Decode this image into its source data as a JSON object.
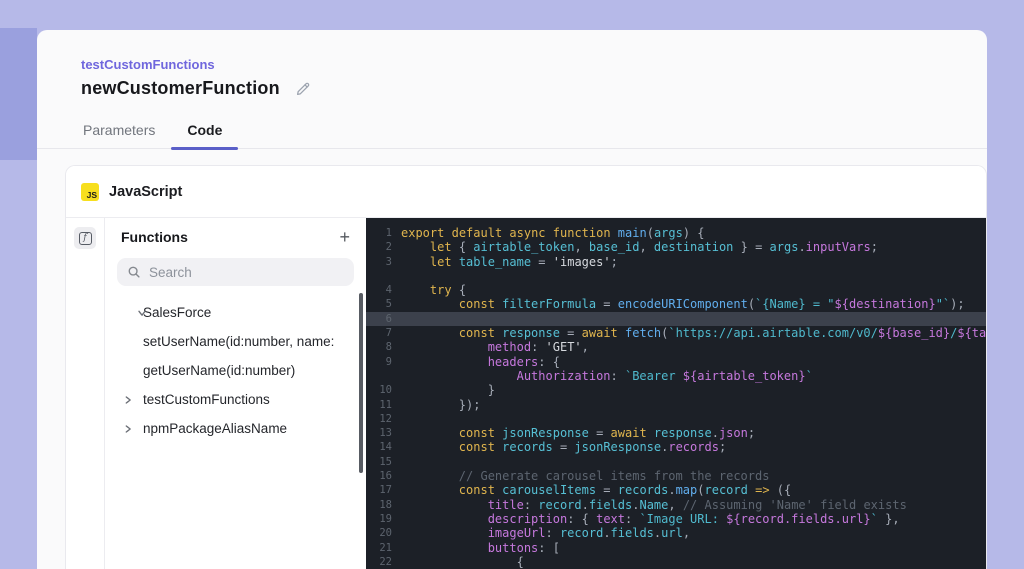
{
  "page": {
    "background_color": "#b6b9e8",
    "accent_color": "#5a5fc8",
    "breadcrumb_color": "#6f66dd"
  },
  "header": {
    "breadcrumb": "testCustomFunctions",
    "title": "newCustomerFunction",
    "tabs": [
      {
        "label": "Parameters",
        "active": false
      },
      {
        "label": "Code",
        "active": true
      }
    ]
  },
  "editor_card": {
    "language_badge": "JS",
    "language_badge_color": "#f7df1e",
    "language_label": "JavaScript"
  },
  "functions_panel": {
    "title": "Functions",
    "add_button": "+",
    "search_placeholder": "Search",
    "tree": [
      {
        "chevron": "down",
        "label": "SalesForce"
      },
      {
        "chevron": "",
        "label": "setUserName(id:number, name:"
      },
      {
        "chevron": "",
        "label": "getUserName(id:number)"
      },
      {
        "chevron": "right",
        "label": "testCustomFunctions"
      },
      {
        "chevron": "right",
        "label": "npmPackageAliasName"
      }
    ]
  },
  "code_editor": {
    "background_color": "#1c2027",
    "active_line_color": "#3c414c",
    "active_line_number": "6",
    "lines": [
      {
        "n": "1",
        "hl": false,
        "toks": [
          [
            "kw",
            "export"
          ],
          [
            "o",
            " "
          ],
          [
            "kw",
            "default"
          ],
          [
            "o",
            " "
          ],
          [
            "kw",
            "async"
          ],
          [
            "o",
            " "
          ],
          [
            "kw",
            "function"
          ],
          [
            "o",
            " "
          ],
          [
            "fn",
            "main"
          ],
          [
            "o",
            "("
          ],
          [
            "v",
            "args"
          ],
          [
            "o",
            ") {"
          ]
        ]
      },
      {
        "n": "2",
        "hl": false,
        "toks": [
          [
            "o",
            "    "
          ],
          [
            "kw",
            "let"
          ],
          [
            "o",
            " { "
          ],
          [
            "v",
            "airtable_token"
          ],
          [
            "o",
            ", "
          ],
          [
            "v",
            "base_id"
          ],
          [
            "o",
            ", "
          ],
          [
            "v",
            "destination"
          ],
          [
            "o",
            " } = "
          ],
          [
            "v",
            "args"
          ],
          [
            "o",
            "."
          ],
          [
            "p",
            "inputVars"
          ],
          [
            "o",
            ";"
          ]
        ]
      },
      {
        "n": "3",
        "hl": false,
        "toks": [
          [
            "o",
            "    "
          ],
          [
            "kw",
            "let"
          ],
          [
            "o",
            " "
          ],
          [
            "v",
            "table_name"
          ],
          [
            "o",
            " = "
          ],
          [
            "s",
            "'images'"
          ],
          [
            "o",
            ";"
          ]
        ]
      },
      {
        "n": "",
        "hl": false,
        "toks": []
      },
      {
        "n": "4",
        "hl": false,
        "toks": [
          [
            "o",
            "    "
          ],
          [
            "kw",
            "try"
          ],
          [
            "o",
            " {"
          ]
        ]
      },
      {
        "n": "5",
        "hl": false,
        "toks": [
          [
            "o",
            "        "
          ],
          [
            "kw",
            "const"
          ],
          [
            "o",
            " "
          ],
          [
            "v",
            "filterFormula"
          ],
          [
            "o",
            " = "
          ],
          [
            "fn",
            "encodeURIComponent"
          ],
          [
            "o",
            "("
          ],
          [
            "t",
            "`{Name} = \""
          ],
          [
            "p",
            "${destination}"
          ],
          [
            "t",
            "\"`"
          ],
          [
            "o",
            ");"
          ]
        ]
      },
      {
        "n": "6",
        "hl": true,
        "toks": []
      },
      {
        "n": "7",
        "hl": false,
        "toks": [
          [
            "o",
            "        "
          ],
          [
            "kw",
            "const"
          ],
          [
            "o",
            " "
          ],
          [
            "v",
            "response"
          ],
          [
            "o",
            " = "
          ],
          [
            "kw",
            "await"
          ],
          [
            "o",
            " "
          ],
          [
            "fn",
            "fetch"
          ],
          [
            "o",
            "("
          ],
          [
            "t",
            "`https://api.airtable.com/v0/"
          ],
          [
            "p",
            "${base_id}"
          ],
          [
            "t",
            "/"
          ],
          [
            "p",
            "${ta"
          ]
        ]
      },
      {
        "n": "8",
        "hl": false,
        "toks": [
          [
            "o",
            "            "
          ],
          [
            "p",
            "method"
          ],
          [
            "o",
            ": "
          ],
          [
            "s",
            "'GET'"
          ],
          [
            "o",
            ","
          ]
        ]
      },
      {
        "n": "9",
        "hl": false,
        "toks": [
          [
            "o",
            "            "
          ],
          [
            "p",
            "headers"
          ],
          [
            "o",
            ": {"
          ]
        ]
      },
      {
        "n": "",
        "hl": false,
        "toks": [
          [
            "o",
            "                "
          ],
          [
            "p",
            "Authorization"
          ],
          [
            "o",
            ": "
          ],
          [
            "t",
            "`Bearer "
          ],
          [
            "p",
            "${airtable_token}"
          ],
          [
            "t",
            "`"
          ]
        ]
      },
      {
        "n": "10",
        "hl": false,
        "toks": [
          [
            "o",
            "            }"
          ]
        ]
      },
      {
        "n": "11",
        "hl": false,
        "toks": [
          [
            "o",
            "        });"
          ]
        ]
      },
      {
        "n": "12",
        "hl": false,
        "toks": []
      },
      {
        "n": "13",
        "hl": false,
        "toks": [
          [
            "o",
            "        "
          ],
          [
            "kw",
            "const"
          ],
          [
            "o",
            " "
          ],
          [
            "v",
            "jsonResponse"
          ],
          [
            "o",
            " = "
          ],
          [
            "kw",
            "await"
          ],
          [
            "o",
            " "
          ],
          [
            "v",
            "response"
          ],
          [
            "o",
            "."
          ],
          [
            "p",
            "json"
          ],
          [
            "o",
            ";"
          ]
        ]
      },
      {
        "n": "14",
        "hl": false,
        "toks": [
          [
            "o",
            "        "
          ],
          [
            "kw",
            "const"
          ],
          [
            "o",
            " "
          ],
          [
            "v",
            "records"
          ],
          [
            "o",
            " = "
          ],
          [
            "v",
            "jsonResponse"
          ],
          [
            "o",
            "."
          ],
          [
            "p",
            "records"
          ],
          [
            "o",
            ";"
          ]
        ]
      },
      {
        "n": "15",
        "hl": false,
        "toks": []
      },
      {
        "n": "16",
        "hl": false,
        "toks": [
          [
            "o",
            "        "
          ],
          [
            "c",
            "// Generate carousel items from the records"
          ]
        ]
      },
      {
        "n": "17",
        "hl": false,
        "toks": [
          [
            "o",
            "        "
          ],
          [
            "kw",
            "const"
          ],
          [
            "o",
            " "
          ],
          [
            "v",
            "carouselItems"
          ],
          [
            "o",
            " = "
          ],
          [
            "v",
            "records"
          ],
          [
            "o",
            "."
          ],
          [
            "fn",
            "map"
          ],
          [
            "o",
            "("
          ],
          [
            "v",
            "record"
          ],
          [
            "o",
            " "
          ],
          [
            "kw",
            "=>"
          ],
          [
            "o",
            " ({"
          ]
        ]
      },
      {
        "n": "18",
        "hl": false,
        "toks": [
          [
            "o",
            "            "
          ],
          [
            "p",
            "title"
          ],
          [
            "o",
            ": "
          ],
          [
            "v",
            "record"
          ],
          [
            "o",
            "."
          ],
          [
            "v",
            "fields"
          ],
          [
            "o",
            "."
          ],
          [
            "v",
            "Name"
          ],
          [
            "o",
            ", "
          ],
          [
            "c",
            "// Assuming 'Name' field exists"
          ]
        ]
      },
      {
        "n": "19",
        "hl": false,
        "toks": [
          [
            "o",
            "            "
          ],
          [
            "p",
            "description"
          ],
          [
            "o",
            ": { "
          ],
          [
            "p",
            "text"
          ],
          [
            "o",
            ": "
          ],
          [
            "t",
            "`Image URL: "
          ],
          [
            "p",
            "${record.fields.url}"
          ],
          [
            "t",
            "`"
          ],
          [
            "o",
            " },"
          ]
        ]
      },
      {
        "n": "20",
        "hl": false,
        "toks": [
          [
            "o",
            "            "
          ],
          [
            "p",
            "imageUrl"
          ],
          [
            "o",
            ": "
          ],
          [
            "v",
            "record"
          ],
          [
            "o",
            "."
          ],
          [
            "v",
            "fields"
          ],
          [
            "o",
            "."
          ],
          [
            "v",
            "url"
          ],
          [
            "o",
            ","
          ]
        ]
      },
      {
        "n": "21",
        "hl": false,
        "toks": [
          [
            "o",
            "            "
          ],
          [
            "p",
            "buttons"
          ],
          [
            "o",
            ": ["
          ]
        ]
      },
      {
        "n": "22",
        "hl": false,
        "toks": [
          [
            "o",
            "                {"
          ]
        ]
      }
    ]
  }
}
